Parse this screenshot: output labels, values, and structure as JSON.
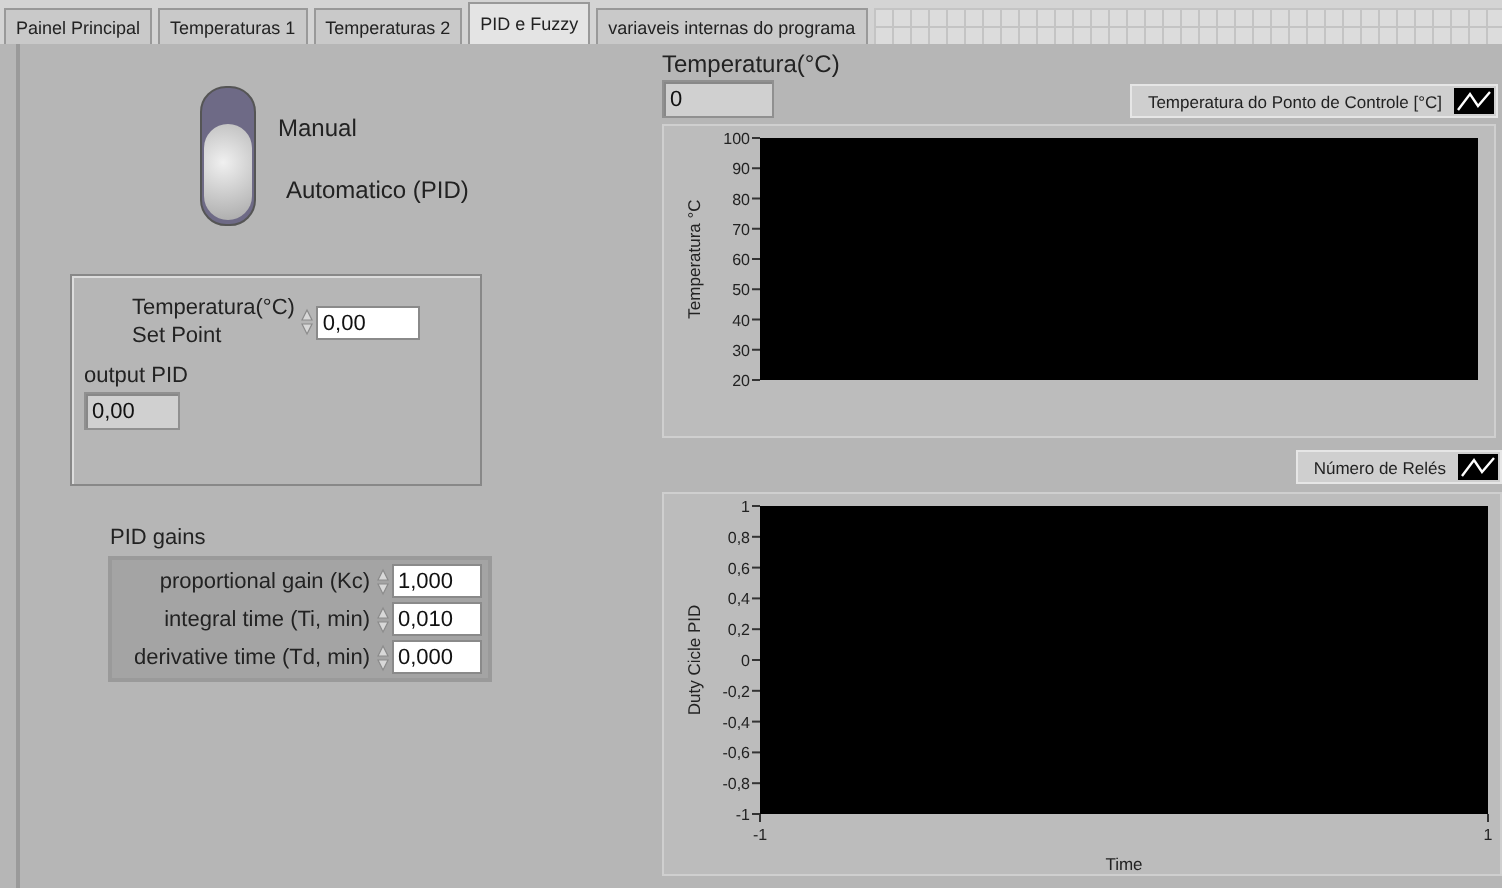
{
  "tabs": [
    {
      "label": "Painel Principal",
      "selected": false
    },
    {
      "label": "Temperaturas 1",
      "selected": false
    },
    {
      "label": "Temperaturas 2",
      "selected": false
    },
    {
      "label": "PID e Fuzzy",
      "selected": true
    },
    {
      "label": "variaveis internas do programa",
      "selected": false
    }
  ],
  "mode_switch": {
    "labels": [
      "Manual",
      "Automatico (PID)"
    ],
    "on": true
  },
  "setpoint_group": {
    "setpoint": {
      "label": "Temperatura(°C)\nSet Point",
      "value": "0,00"
    },
    "output": {
      "label": "output PID",
      "value": "0,00"
    }
  },
  "pid_gains": {
    "title": "PID gains",
    "rows": [
      {
        "label": "proportional gain (Kc)",
        "value": "1,000"
      },
      {
        "label": "integral time (Ti, min)",
        "value": "0,010"
      },
      {
        "label": "derivative time (Td, min)",
        "value": "0,000"
      }
    ]
  },
  "temperature_indicator": {
    "label": "Temperatura(°C)",
    "value": "0"
  },
  "temperature_chart": {
    "legend": "Temperatura do Ponto de Controle [°C]",
    "y_axis_title": "Temperatura °C",
    "y_tick_labels": [
      "100",
      "90",
      "80",
      "70",
      "60",
      "50",
      "40",
      "30",
      "20"
    ]
  },
  "relay_chart": {
    "legend": "Número de Relés",
    "y_axis_title": "Duty Cicle PID",
    "y_tick_labels": [
      "1",
      "0,8",
      "0,6",
      "0,4",
      "0,2",
      "0",
      "-0,2",
      "-0,4",
      "-0,6",
      "-0,8",
      "-1"
    ],
    "x_tick_labels": [
      "-1",
      "1"
    ],
    "x_axis_title": "Time"
  }
}
